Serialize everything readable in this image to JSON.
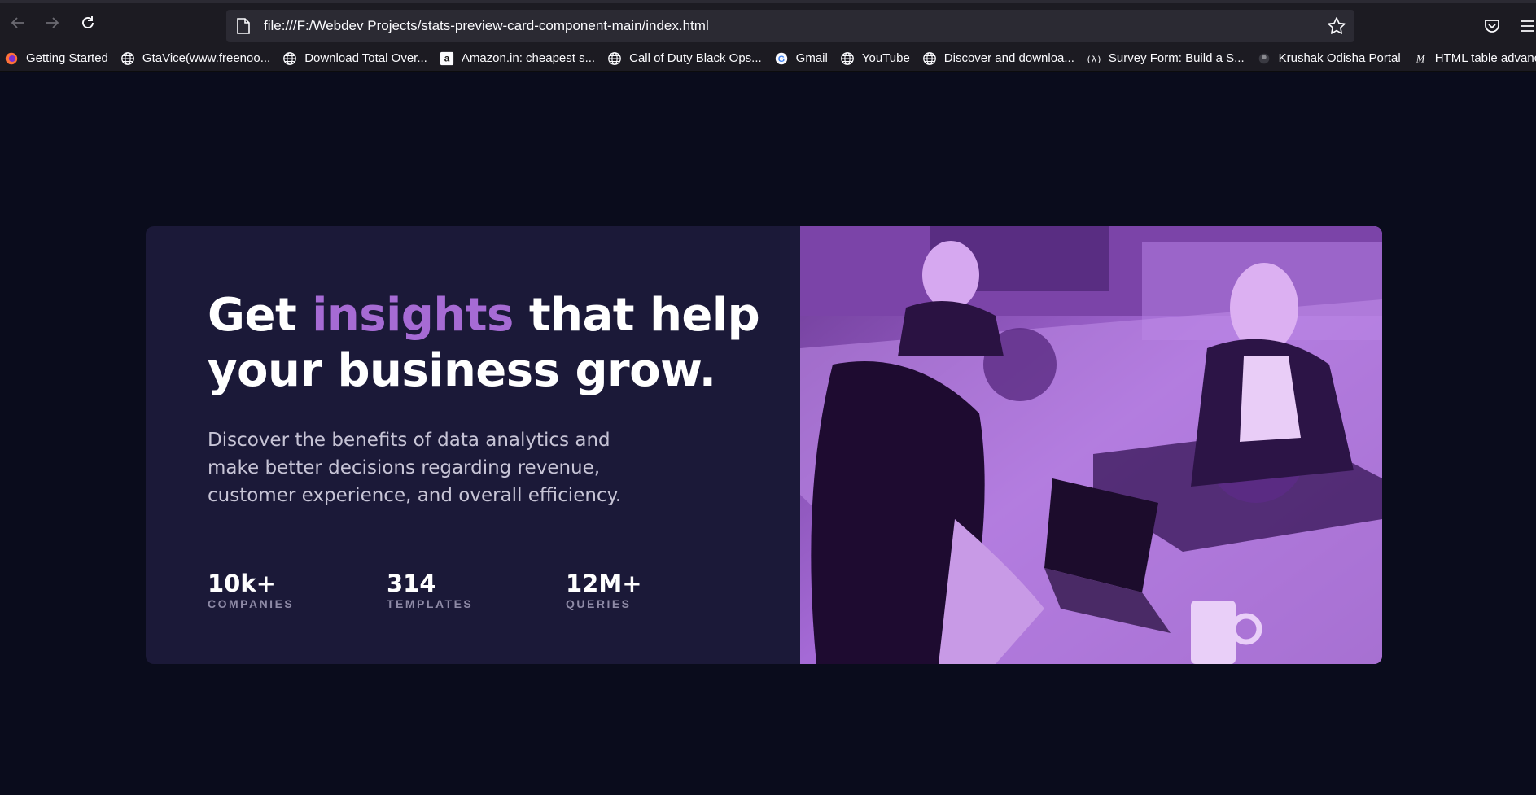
{
  "browser": {
    "url": "file:///F:/Webdev Projects/stats-preview-card-component-main/index.html",
    "bookmarks": [
      {
        "label": "Getting Started",
        "icon": "firefox-icon"
      },
      {
        "label": "GtaVice(www.freenoo...",
        "icon": "globe-icon"
      },
      {
        "label": "Download Total Over...",
        "icon": "globe-icon"
      },
      {
        "label": "Amazon.in: cheapest s...",
        "icon": "amazon-icon"
      },
      {
        "label": "Call of Duty Black Ops...",
        "icon": "globe-icon"
      },
      {
        "label": "Gmail",
        "icon": "google-icon"
      },
      {
        "label": "YouTube",
        "icon": "globe-icon"
      },
      {
        "label": "Discover and downloa...",
        "icon": "globe-icon"
      },
      {
        "label": "Survey Form: Build a S...",
        "icon": "freecodecamp-icon"
      },
      {
        "label": "Krushak Odisha Portal",
        "icon": "emblem-icon"
      },
      {
        "label": "HTML table advanced ...",
        "icon": "mdn-icon"
      }
    ]
  },
  "card": {
    "headline_before": "Get ",
    "headline_accent": "insights",
    "headline_after": " that help your business grow.",
    "description": "Discover the benefits of data analytics and make better decisions regarding revenue, customer experience, and overall efficiency.",
    "stats": [
      {
        "value": "10k+",
        "label": "COMPANIES"
      },
      {
        "value": "314",
        "label": "TEMPLATES"
      },
      {
        "value": "12M+",
        "label": "QUERIES"
      }
    ],
    "image_alt": "People working at a shared office table"
  },
  "colors": {
    "page_bg": "#0a0c1c",
    "card_bg": "#1b1938",
    "accent": "#a66bd4",
    "photo_tint": "#9a5cc9"
  }
}
